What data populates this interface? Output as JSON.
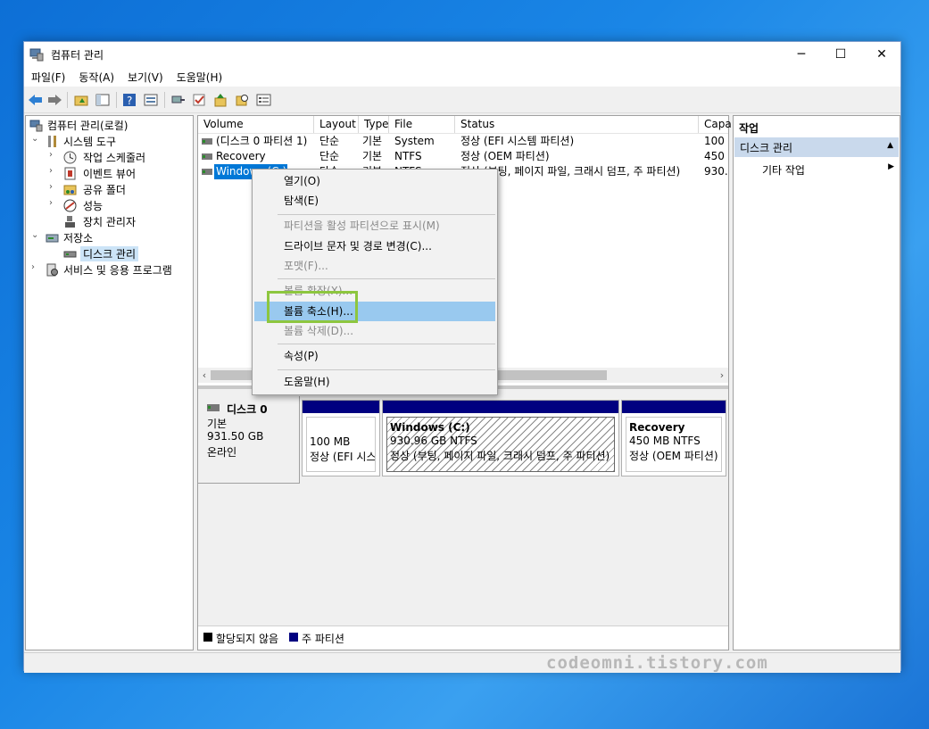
{
  "window": {
    "title": "컴퓨터 관리",
    "minimize_glyph": "─",
    "maximize_glyph": "☐",
    "close_glyph": "✕"
  },
  "menubar": [
    {
      "label": "파일(F)"
    },
    {
      "label": "동작(A)"
    },
    {
      "label": "보기(V)"
    },
    {
      "label": "도움말(H)"
    }
  ],
  "toolbar_icons": [
    "back-arrow-icon",
    "forward-arrow-icon",
    "folder-up-icon",
    "show-hide-tree-icon",
    "help-icon",
    "properties-icon",
    "connect-icon",
    "check-icon",
    "export-icon",
    "search-icon",
    "details-icon"
  ],
  "tree": {
    "root": "컴퓨터 관리(로컬)",
    "system_tools": "시스템 도구",
    "task_scheduler": "작업 스케줄러",
    "event_viewer": "이벤트 뷰어",
    "shared_folders": "공유 폴더",
    "performance": "성능",
    "device_manager": "장치 관리자",
    "storage": "저장소",
    "disk_management": "디스크 관리",
    "services_apps": "서비스 및 응용 프로그램"
  },
  "volume_list": {
    "columns": [
      "Volume",
      "Layout",
      "Type",
      "File System",
      "Status",
      "Capa"
    ],
    "rows": [
      {
        "volume": "(디스크 0 파티션 1)",
        "layout": "단순",
        "type": "기본",
        "fs": "",
        "status": "정상 (EFI 시스템 파티션)",
        "capacity": "100 I"
      },
      {
        "volume": "Recovery",
        "layout": "단순",
        "type": "기본",
        "fs": "NTFS",
        "status": "정상 (OEM 파티션)",
        "capacity": "450 I"
      },
      {
        "volume": "Windows (C:)",
        "layout": "단순",
        "type": "기본",
        "fs": "NTFS",
        "status": "정상 (부팅, 페이지 파일, 크래시 덤프, 주 파티션)",
        "capacity": "930.9"
      }
    ]
  },
  "disk": {
    "name": "디스크 0",
    "type": "기본",
    "size": "931.50 GB",
    "state": "온라인",
    "partitions": [
      {
        "line1": "",
        "line2": "100 MB",
        "line3": "정상 (EFI 시스"
      },
      {
        "line1": "Windows  (C:)",
        "line2": "930.96 GB NTFS",
        "line3": "정상 (부팅, 페이지 파일, 크래시 덤프, 주 파티션)"
      },
      {
        "line1": "Recovery",
        "line2": "450 MB NTFS",
        "line3": "정상 (OEM 파티션)"
      }
    ]
  },
  "legend": {
    "unallocated": "할당되지 않음",
    "primary": "주 파티션",
    "unallocated_color": "#000000",
    "primary_color": "#000080"
  },
  "actions": {
    "title": "작업",
    "section": "디스크 관리",
    "more": "기타 작업"
  },
  "context_menu": {
    "items": [
      {
        "label": "열기(O)",
        "disabled": false
      },
      {
        "label": "탐색(E)",
        "disabled": false
      },
      {
        "label": "파티션을 활성 파티션으로 표시(M)",
        "disabled": true
      },
      {
        "label": "드라이브 문자 및 경로 변경(C)...",
        "disabled": false
      },
      {
        "label": "포맷(F)...",
        "disabled": true
      },
      {
        "label": "볼륨 확장(X)...",
        "disabled": true
      },
      {
        "label": "볼륨 축소(H)...",
        "disabled": false,
        "hovered": true
      },
      {
        "label": "볼륨 삭제(D)...",
        "disabled": true
      },
      {
        "label": "속성(P)",
        "disabled": false
      },
      {
        "label": "도움말(H)",
        "disabled": false
      }
    ],
    "highlight_color": "#8dc63f"
  },
  "watermark": "codeomni.tistory.com"
}
